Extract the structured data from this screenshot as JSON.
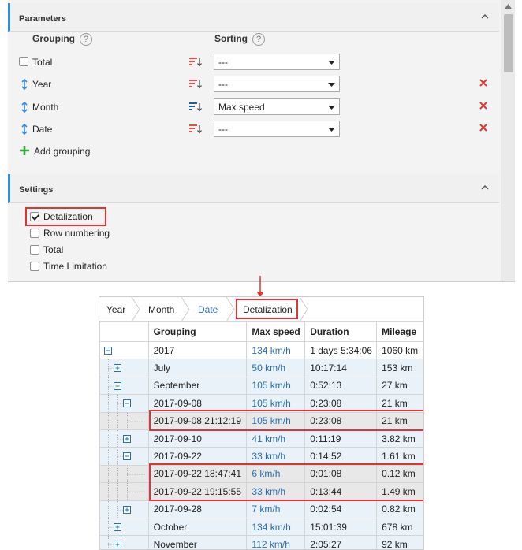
{
  "parameters": {
    "title": "Parameters",
    "grouping_header": "Grouping",
    "sorting_header": "Sorting",
    "rows": [
      {
        "label": "Total",
        "lead": "checkbox",
        "sort": "---",
        "sort_icon": "sort-desc-icon",
        "removable": false
      },
      {
        "label": "Year",
        "lead": "move",
        "sort": "---",
        "sort_icon": "sort-desc-icon",
        "removable": true
      },
      {
        "label": "Month",
        "lead": "move",
        "sort": "Max speed",
        "sort_icon": "sort-desc-active-icon",
        "removable": true
      },
      {
        "label": "Date",
        "lead": "move",
        "sort": "---",
        "sort_icon": "sort-desc-icon",
        "removable": true
      }
    ],
    "add_grouping": "Add grouping",
    "help_glyph": "?"
  },
  "settings": {
    "title": "Settings",
    "options": [
      {
        "label": "Detalization",
        "checked": true
      },
      {
        "label": "Row numbering",
        "checked": false
      },
      {
        "label": "Total",
        "checked": false
      },
      {
        "label": "Time Limitation",
        "checked": false
      }
    ]
  },
  "breadcrumbs": [
    {
      "label": "Year",
      "link": false
    },
    {
      "label": "Month",
      "link": false
    },
    {
      "label": "Date",
      "link": true
    },
    {
      "label": "Detalization",
      "link": false
    }
  ],
  "report": {
    "columns": [
      "Grouping",
      "Max speed",
      "Duration",
      "Mileage"
    ],
    "rows": [
      {
        "level": 0,
        "toggle": "minus",
        "grouping": "2017",
        "max_speed": "134 km/h",
        "duration": "1 days 5:34:06",
        "mileage": "1060 km",
        "kind": "top"
      },
      {
        "level": 1,
        "toggle": "plus",
        "grouping": "July",
        "max_speed": "50 km/h",
        "duration": "10:17:14",
        "mileage": "153 km",
        "kind": "shade"
      },
      {
        "level": 1,
        "toggle": "minus",
        "grouping": "September",
        "max_speed": "105 km/h",
        "duration": "0:52:13",
        "mileage": "27 km",
        "kind": "shade"
      },
      {
        "level": 2,
        "toggle": "minus",
        "grouping": "2017-09-08",
        "max_speed": "105 km/h",
        "duration": "0:23:08",
        "mileage": "21 km",
        "kind": "shade"
      },
      {
        "level": 3,
        "toggle": "none",
        "grouping": "2017-09-08 21:12:19",
        "max_speed": "105 km/h",
        "duration": "0:23:08",
        "mileage": "21 km",
        "kind": "detail"
      },
      {
        "level": 2,
        "toggle": "plus",
        "grouping": "2017-09-10",
        "max_speed": "41 km/h",
        "duration": "0:11:19",
        "mileage": "3.82 km",
        "kind": "shade"
      },
      {
        "level": 2,
        "toggle": "minus",
        "grouping": "2017-09-22",
        "max_speed": "33 km/h",
        "duration": "0:14:52",
        "mileage": "1.61 km",
        "kind": "shade"
      },
      {
        "level": 3,
        "toggle": "none",
        "grouping": "2017-09-22 18:47:41",
        "max_speed": "6 km/h",
        "duration": "0:01:08",
        "mileage": "0.12 km",
        "kind": "detail"
      },
      {
        "level": 3,
        "toggle": "none",
        "grouping": "2017-09-22 19:15:55",
        "max_speed": "33 km/h",
        "duration": "0:13:44",
        "mileage": "1.49 km",
        "kind": "detail"
      },
      {
        "level": 2,
        "toggle": "plus",
        "grouping": "2017-09-28",
        "max_speed": "7 km/h",
        "duration": "0:02:54",
        "mileage": "0.82 km",
        "kind": "shade"
      },
      {
        "level": 1,
        "toggle": "plus",
        "grouping": "October",
        "max_speed": "134 km/h",
        "duration": "15:01:39",
        "mileage": "678 km",
        "kind": "shade"
      },
      {
        "level": 1,
        "toggle": "plus",
        "grouping": "November",
        "max_speed": "112 km/h",
        "duration": "2:05:27",
        "mileage": "92 km",
        "kind": "shade"
      }
    ]
  },
  "colors": {
    "accent_blue": "#2f8ee0",
    "link_blue": "#2a6fb0",
    "highlight_red": "#e03434",
    "remove_red": "#e03434",
    "add_green": "#3aa640",
    "sort_red": "#d9534f"
  }
}
